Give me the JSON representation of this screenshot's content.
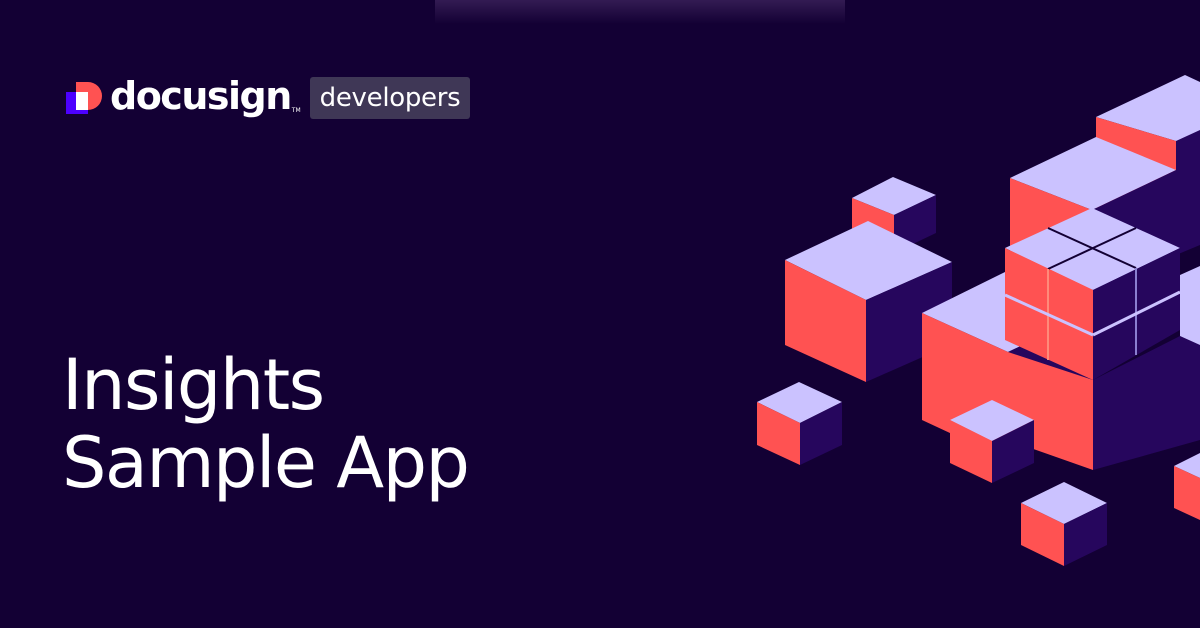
{
  "brand": {
    "logo_icon": "docusign-logo-icon",
    "wordmark": "docusign",
    "trademark": "TM",
    "badge": "developers"
  },
  "title": {
    "line1": "Insights",
    "line2": "Sample App"
  },
  "colors": {
    "background": "#130034",
    "cube_top": "#cbc2ff",
    "cube_left": "#ff5252",
    "cube_right": "#26065d",
    "badge_bg": "#3f3756"
  }
}
